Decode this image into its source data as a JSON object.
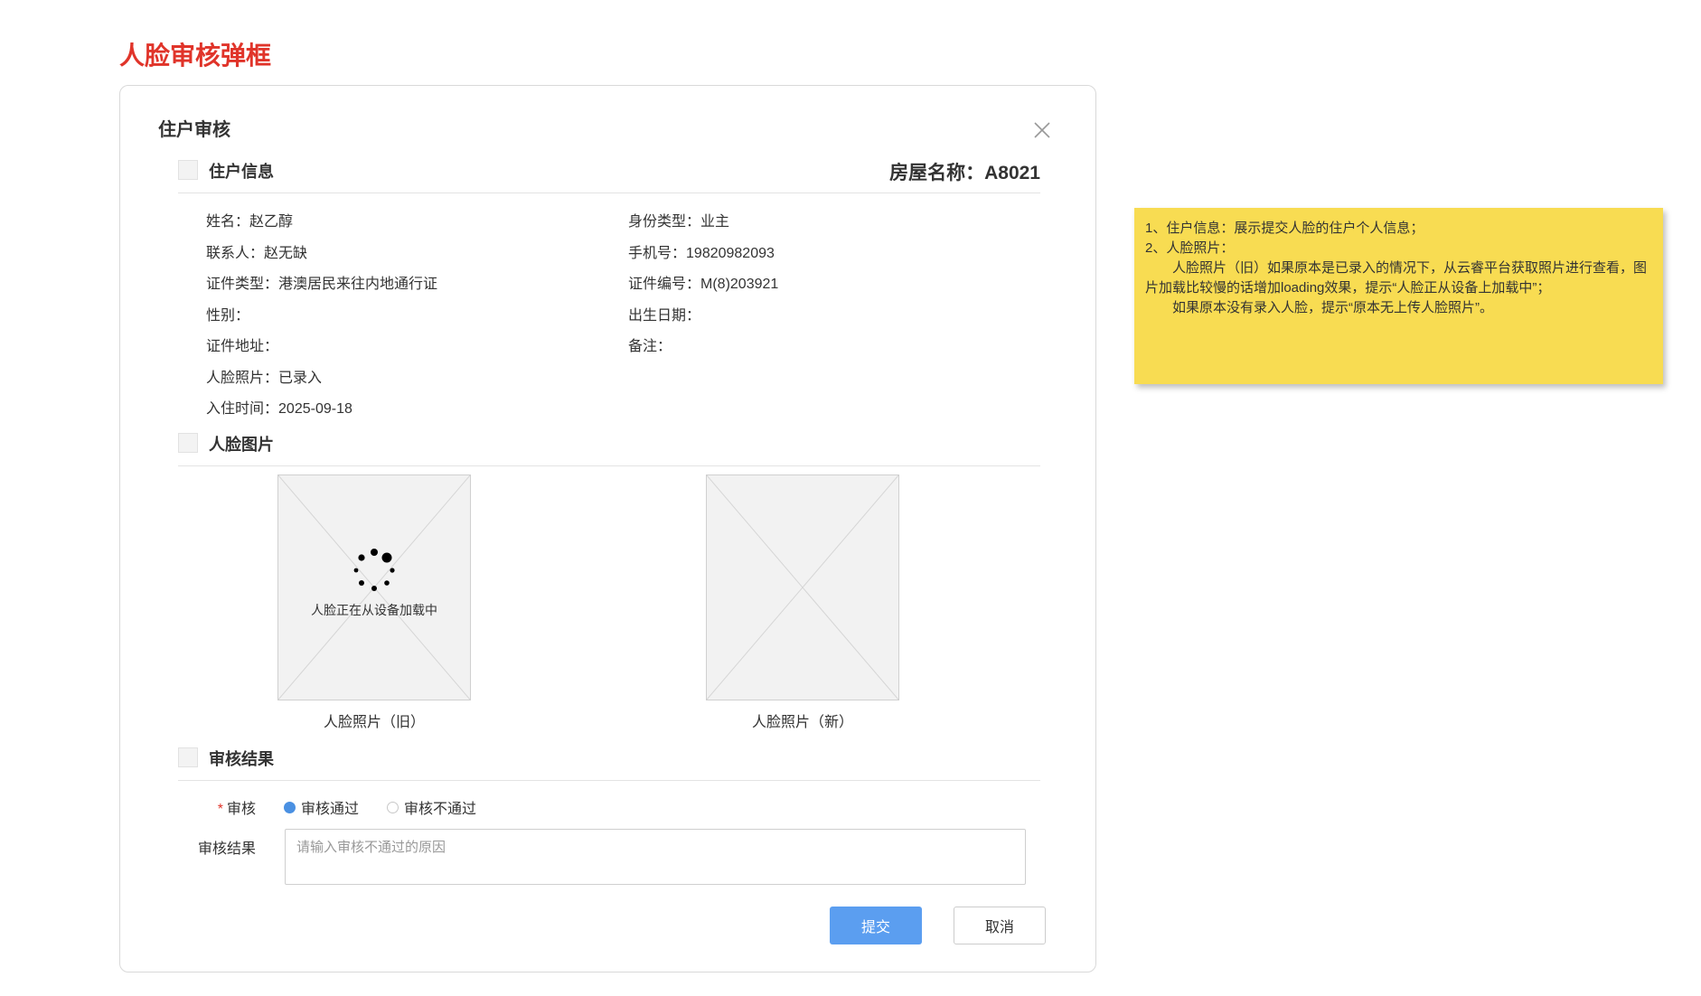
{
  "page_heading": "人脸审核弹框",
  "dialog": {
    "title": "住户审核",
    "resident_section": {
      "title": "住户信息",
      "house_name": "房屋名称：A8021",
      "left_fields": [
        {
          "label": "姓名：",
          "value": "赵乙醇"
        },
        {
          "label": "联系人：",
          "value": "赵无缺"
        },
        {
          "label": "证件类型：",
          "value": "港澳居民来往内地通行证"
        },
        {
          "label": "性别：",
          "value": ""
        },
        {
          "label": "证件地址：",
          "value": ""
        },
        {
          "label": "人脸照片：",
          "value": "已录入"
        },
        {
          "label": "入住时间：",
          "value": "2025-09-18"
        }
      ],
      "right_fields": [
        {
          "label": "身份类型：",
          "value": "业主"
        },
        {
          "label": "手机号：",
          "value": "19820982093"
        },
        {
          "label": "证件编号：",
          "value": "M(8)203921"
        },
        {
          "label": "出生日期：",
          "value": ""
        },
        {
          "label": "备注：",
          "value": ""
        }
      ]
    },
    "photo_section": {
      "title": "人脸图片",
      "old_photo": {
        "caption": "人脸照片（旧）",
        "loading_text": "人脸正在从设备加载中"
      },
      "new_photo": {
        "caption": "人脸照片（新）"
      }
    },
    "review_section": {
      "title": "审核结果",
      "review_label": "审核",
      "required_mark": "*",
      "options": [
        {
          "label": "审核通过",
          "checked": true
        },
        {
          "label": "审核不通过",
          "checked": false
        }
      ],
      "result_label": "审核结果",
      "reason_placeholder": "请输入审核不通过的原因",
      "reason_value": ""
    },
    "buttons": {
      "submit": "提交",
      "cancel": "取消"
    }
  },
  "note": {
    "lines": [
      "1、住户信息：展示提交人脸的住户个人信息；",
      "2、人脸照片：",
      "　　人脸照片（旧）如果原本是已录入的情况下，从云睿平台获取照片进行查看，图片加载比较慢的话增加loading效果，提示“人脸正从设备上加载中”；",
      "　　如果原本没有录入人脸，提示“原本无上传人脸照片”。"
    ]
  },
  "colors": {
    "heading": "#e0342a",
    "primary": "#5b9ef0",
    "note_bg": "#f8dc52",
    "radio_checked": "#4a90e2"
  },
  "icons": [
    "close-icon",
    "section-image-icon",
    "loading-spinner-icon",
    "image-placeholder-icon"
  ]
}
